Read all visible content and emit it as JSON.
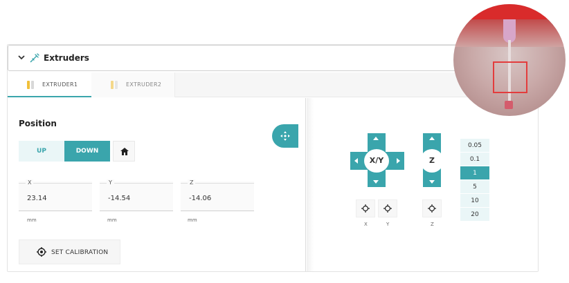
{
  "panel": {
    "title": "Extruders"
  },
  "tabs": [
    {
      "label": "EXTRUDER1",
      "active": true
    },
    {
      "label": "EXTRUDER2",
      "active": false
    }
  ],
  "position": {
    "title": "Position",
    "up_label": "UP",
    "down_label": "DOWN",
    "fields": [
      {
        "label": "X",
        "value": "23.14",
        "unit": "mm"
      },
      {
        "label": "Y",
        "value": "-14.54",
        "unit": "mm"
      },
      {
        "label": "Z",
        "value": "-14.06",
        "unit": "mm"
      }
    ],
    "calibration_label": "SET CALIBRATION"
  },
  "jog": {
    "xy_label": "X/Y",
    "z_label": "Z",
    "center_labels": [
      "X",
      "Y",
      "Z"
    ],
    "steps": [
      "0.05",
      "0.1",
      "1",
      "5",
      "10",
      "20"
    ],
    "selected_step": "1"
  },
  "colors": {
    "accent": "#3aa5ac",
    "accent_light": "#eaf6f7",
    "camera_box": "#e33c3c"
  },
  "icons": {
    "collapse": "chevron-down-icon",
    "panel": "syringe-icon",
    "tab": "extruder-icon",
    "home": "home-icon",
    "calibration": "crosshair-icon",
    "toggle": "move-arrows-icon",
    "center": "target-icon"
  }
}
